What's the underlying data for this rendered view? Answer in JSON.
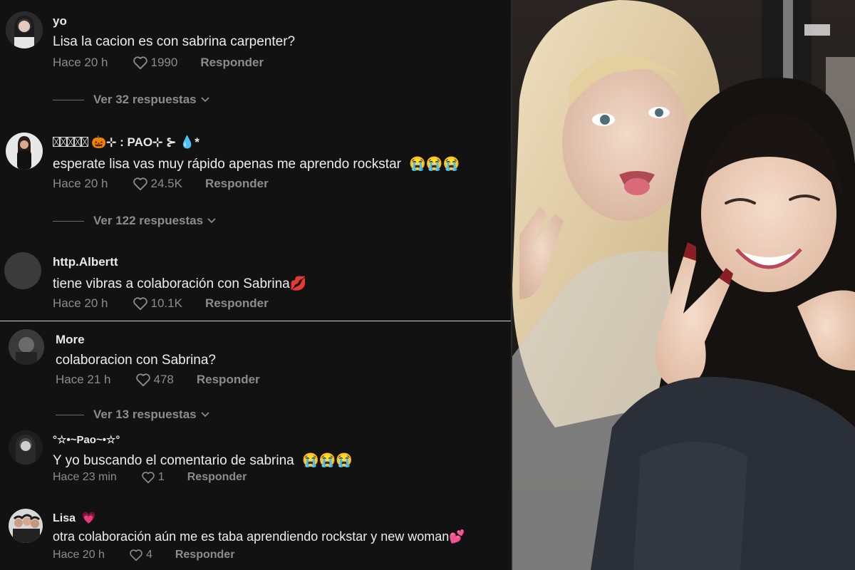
{
  "comments": [
    {
      "user": "yo",
      "text": "Lisa la cacion es con sabrina carpenter?",
      "time": "Hace 20 h",
      "likes": "1990",
      "reply": "Responder",
      "replies": "Ver 32 respuestas"
    },
    {
      "user": "🎃⊹ : PAO⊹ ⊱ 💧*",
      "text": "esperate lisa vas muy rápido apenas me aprendo rockstar",
      "emojis": "😭😭😭",
      "time": "Hace 20 h",
      "likes": "24.5K",
      "reply": "Responder",
      "replies": "Ver 122 respuestas"
    },
    {
      "user": "http.Albertt",
      "text": "tiene vibras a colaboración con Sabrina",
      "emojis": "💋",
      "time": "Hace 20 h",
      "likes": "10.1K",
      "reply": "Responder"
    },
    {
      "user": "More",
      "text": "colaboracion con Sabrina?",
      "time": "Hace 21 h",
      "likes": "478",
      "reply": "Responder",
      "replies": "Ver 13 respuestas"
    },
    {
      "user": "°☆•~Pao~•☆°",
      "text": "Y yo buscando el comentario de sabrina",
      "emojis": "😭😭😭",
      "time": "Hace 23 min",
      "likes": "1",
      "reply": "Responder"
    },
    {
      "user": "Lisa",
      "user_emoji": "💗",
      "text": "otra colaboración aún me es taba aprendiendo rockstar y new woman",
      "emojis": "💕",
      "time": "Hace 20 h",
      "likes": "4",
      "reply": "Responder"
    }
  ],
  "icons": {
    "like": "heart-outline-icon",
    "chevron": "chevron-down-icon"
  },
  "colors": {
    "background": "#121212",
    "text": "#ededed",
    "muted": "#8c8c8c"
  }
}
